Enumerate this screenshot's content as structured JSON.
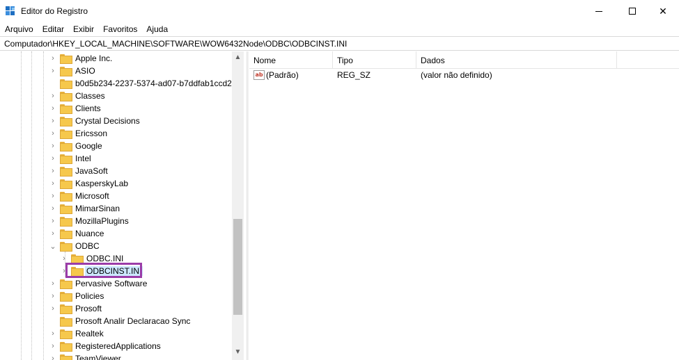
{
  "window": {
    "title": "Editor do Registro"
  },
  "menu": {
    "items": [
      "Arquivo",
      "Editar",
      "Exibir",
      "Favoritos",
      "Ajuda"
    ]
  },
  "address": {
    "path": "Computador\\HKEY_LOCAL_MACHINE\\SOFTWARE\\WOW6432Node\\ODBC\\ODBCINST.INI"
  },
  "tree": {
    "items": [
      "Apple Inc.",
      "ASIO",
      "b0d5b234-2237-5374-ad07-b7ddfab1ccd2",
      "Classes",
      "Clients",
      "Crystal Decisions",
      "Ericsson",
      "Google",
      "Intel",
      "JavaSoft",
      "KasperskyLab",
      "Microsoft",
      "MimarSinan",
      "MozillaPlugins",
      "Nuance",
      "ODBC",
      "ODBC.INI",
      "ODBCINST.INI",
      "Pervasive Software",
      "Policies",
      "Prosoft",
      "Prosoft Analir Declaracao Sync",
      "Realtek",
      "RegisteredApplications",
      "TeamViewer"
    ],
    "selected": "ODBCINST.INI"
  },
  "list": {
    "columns": {
      "name": "Nome",
      "type": "Tipo",
      "data": "Dados"
    },
    "rows": [
      {
        "name": "(Padrão)",
        "type": "REG_SZ",
        "data": "(valor não definido)"
      }
    ]
  },
  "colors": {
    "highlight_box": "#9b3ca8",
    "selection": "#cce8ff",
    "folder": "#f6c84c"
  },
  "icons": {
    "app": "registry-editor-icon",
    "folder": "folder-icon",
    "value": "string-value-icon"
  }
}
